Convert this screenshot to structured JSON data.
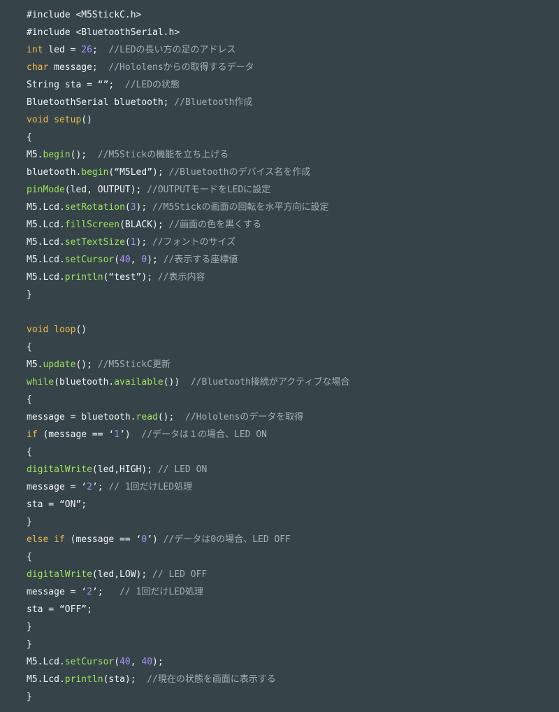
{
  "theme": {
    "background": "#36444a",
    "default_text": "#f3f4f5",
    "keyword": "#f0b94a",
    "function": "#9fe35a",
    "number": "#a98ff5",
    "comment": "#a5aeb4",
    "spellcheck_underline": "#d0323c"
  },
  "code_lines": [
    [
      {
        "t": "#include <M5StickC.h>",
        "k": "plain"
      }
    ],
    [
      {
        "t": "#include <BluetoothSerial.h>",
        "k": "plain"
      }
    ],
    [
      {
        "t": "int",
        "k": "type"
      },
      {
        "t": " led = ",
        "k": "plain"
      },
      {
        "t": "26",
        "k": "number"
      },
      {
        "t": ";  ",
        "k": "plain"
      },
      {
        "t": "//LEDの長い方の足のアドレス",
        "k": "comment"
      }
    ],
    [
      {
        "t": "char",
        "k": "type"
      },
      {
        "t": " message;  ",
        "k": "plain"
      },
      {
        "t": "//Hololensからの取得するデータ",
        "k": "comment"
      }
    ],
    [
      {
        "t": "String sta = ",
        "k": "plain"
      },
      {
        "t": "“”",
        "k": "string"
      },
      {
        "t": ";  ",
        "k": "plain"
      },
      {
        "t": "//LEDの状態",
        "k": "comment"
      }
    ],
    [
      {
        "t": "BluetoothSerial bluetooth; ",
        "k": "plain"
      },
      {
        "t": "//Bluetooth作成",
        "k": "comment"
      }
    ],
    [
      {
        "t": "void",
        "k": "type"
      },
      {
        "t": " ",
        "k": "plain"
      },
      {
        "t": "setup",
        "k": "keyword"
      },
      {
        "t": "()",
        "k": "plain"
      }
    ],
    [
      {
        "t": "{",
        "k": "plain"
      }
    ],
    [
      {
        "t": "M5.",
        "k": "plain"
      },
      {
        "t": "begin",
        "k": "func"
      },
      {
        "t": "();  ",
        "k": "plain"
      },
      {
        "t": "//M5Stickの機能を立ち上げる",
        "k": "comment"
      }
    ],
    [
      {
        "t": "bluetooth.",
        "k": "plain"
      },
      {
        "t": "begin",
        "k": "func"
      },
      {
        "t": "(“M5Led”); ",
        "k": "plain"
      },
      {
        "t": "//Bluetoothのデバイス名を作成",
        "k": "comment"
      }
    ],
    [
      {
        "t": "pinMode",
        "k": "func"
      },
      {
        "t": "(led, OUTPUT); ",
        "k": "plain"
      },
      {
        "t": "//OUTPUTモードをLEDに設定",
        "k": "comment"
      }
    ],
    [
      {
        "t": "M5.Lcd.",
        "k": "plain"
      },
      {
        "t": "setRotation",
        "k": "func"
      },
      {
        "t": "(",
        "k": "plain"
      },
      {
        "t": "3",
        "k": "number"
      },
      {
        "t": "); ",
        "k": "plain"
      },
      {
        "t": "//M5Stickの画面の回転を水平方向に設定",
        "k": "comment"
      }
    ],
    [
      {
        "t": "M5.Lcd.",
        "k": "plain"
      },
      {
        "t": "fillScreen",
        "k": "func"
      },
      {
        "t": "(BLACK); ",
        "k": "plain"
      },
      {
        "t": "//画面の色を黒くする",
        "k": "comment"
      }
    ],
    [
      {
        "t": "M5.Lcd.",
        "k": "plain"
      },
      {
        "t": "setTextSize",
        "k": "func"
      },
      {
        "t": "(",
        "k": "plain"
      },
      {
        "t": "1",
        "k": "number"
      },
      {
        "t": "); ",
        "k": "plain"
      },
      {
        "t": "//フォントのサイズ",
        "k": "comment"
      }
    ],
    [
      {
        "t": "M5.Lcd.",
        "k": "plain"
      },
      {
        "t": "setCursor",
        "k": "func"
      },
      {
        "t": "(",
        "k": "plain"
      },
      {
        "t": "40",
        "k": "number"
      },
      {
        "t": ", ",
        "k": "plain"
      },
      {
        "t": "0",
        "k": "number"
      },
      {
        "t": "); ",
        "k": "plain"
      },
      {
        "t": "//表示する座標値",
        "k": "comment"
      }
    ],
    [
      {
        "t": "M5.Lcd.",
        "k": "plain"
      },
      {
        "t": "println",
        "k": "func"
      },
      {
        "t": "(“test”); ",
        "k": "plain"
      },
      {
        "t": "//表示内容",
        "k": "comment"
      }
    ],
    [
      {
        "t": "}",
        "k": "plain"
      }
    ],
    [],
    [
      {
        "t": "void",
        "k": "type"
      },
      {
        "t": " ",
        "k": "plain"
      },
      {
        "t": "loop",
        "k": "keyword"
      },
      {
        "t": "()",
        "k": "plain"
      }
    ],
    [
      {
        "t": "{",
        "k": "plain"
      }
    ],
    [
      {
        "t": "M5.",
        "k": "plain"
      },
      {
        "t": "update",
        "k": "func"
      },
      {
        "t": "(); ",
        "k": "plain"
      },
      {
        "t": "//M5StickC更新",
        "k": "comment"
      }
    ],
    [
      {
        "t": "while",
        "k": "func"
      },
      {
        "t": "(bluetooth.",
        "k": "plain"
      },
      {
        "t": "available",
        "k": "func"
      },
      {
        "t": "())  ",
        "k": "plain"
      },
      {
        "t": "//Bluetooth接続がアクティブな場合",
        "k": "comment"
      }
    ],
    [
      {
        "t": "{",
        "k": "plain"
      }
    ],
    [
      {
        "t": "message = bluetooth.",
        "k": "plain"
      },
      {
        "t": "read",
        "k": "func"
      },
      {
        "t": "();  ",
        "k": "plain"
      },
      {
        "t": "//Hololensのデータを取得",
        "k": "comment"
      }
    ],
    [
      {
        "t": "if",
        "k": "keyword"
      },
      {
        "t": " (message == ‘",
        "k": "plain"
      },
      {
        "t": "1",
        "k": "number"
      },
      {
        "t": "’)  ",
        "k": "plain"
      },
      {
        "t": "//データは１の場合、LED ON",
        "k": "comment"
      }
    ],
    [
      {
        "t": "{",
        "k": "plain"
      }
    ],
    [
      {
        "t": "digitalWrite",
        "k": "func"
      },
      {
        "t": "(led,HIGH); ",
        "k": "plain"
      },
      {
        "t": "// LED ON",
        "k": "comment"
      }
    ],
    [
      {
        "t": "message = ‘",
        "k": "plain"
      },
      {
        "t": "2",
        "k": "number"
      },
      {
        "t": "’; ",
        "k": "plain"
      },
      {
        "t": "// 1回だけLED処理",
        "k": "comment"
      }
    ],
    [
      {
        "t": "sta = “ON”;",
        "k": "plain"
      }
    ],
    [
      {
        "t": "}",
        "k": "plain"
      }
    ],
    [
      {
        "t": "else",
        "k": "keyword"
      },
      {
        "t": " ",
        "k": "plain"
      },
      {
        "t": "if",
        "k": "keyword"
      },
      {
        "t": " (message == ‘",
        "k": "plain"
      },
      {
        "t": "0",
        "k": "number"
      },
      {
        "t": "’) ",
        "k": "plain"
      },
      {
        "t": "//データは0の場合、LED OFF",
        "k": "comment"
      }
    ],
    [
      {
        "t": "{",
        "k": "plain"
      }
    ],
    [
      {
        "t": "digitalWrite",
        "k": "func"
      },
      {
        "t": "(led,LOW); ",
        "k": "plain"
      },
      {
        "t": "// LED OFF",
        "k": "comment"
      }
    ],
    [
      {
        "t": "message = ‘",
        "k": "plain"
      },
      {
        "t": "2",
        "k": "number"
      },
      {
        "t": "’;   ",
        "k": "plain"
      },
      {
        "t": "// 1回だけLED処理",
        "k": "comment"
      }
    ],
    [
      {
        "t": "sta = “OFF”;",
        "k": "plain"
      }
    ],
    [
      {
        "t": "}",
        "k": "plain"
      }
    ],
    [
      {
        "t": "}",
        "k": "plain"
      }
    ],
    [
      {
        "t": "M5.Lcd.",
        "k": "plain"
      },
      {
        "t": "setCursor",
        "k": "func"
      },
      {
        "t": "(",
        "k": "plain"
      },
      {
        "t": "40",
        "k": "number"
      },
      {
        "t": ", ",
        "k": "plain"
      },
      {
        "t": "40",
        "k": "number"
      },
      {
        "t": ");",
        "k": "plain"
      }
    ],
    [
      {
        "t": "M5.Lcd.",
        "k": "plain"
      },
      {
        "t": "println",
        "k": "func"
      },
      {
        "t": "(sta);  ",
        "k": "plain"
      },
      {
        "t": "//現在の状態を画面に表示する",
        "k": "comment"
      }
    ],
    [
      {
        "t": "}",
        "k": "plain"
      }
    ]
  ]
}
